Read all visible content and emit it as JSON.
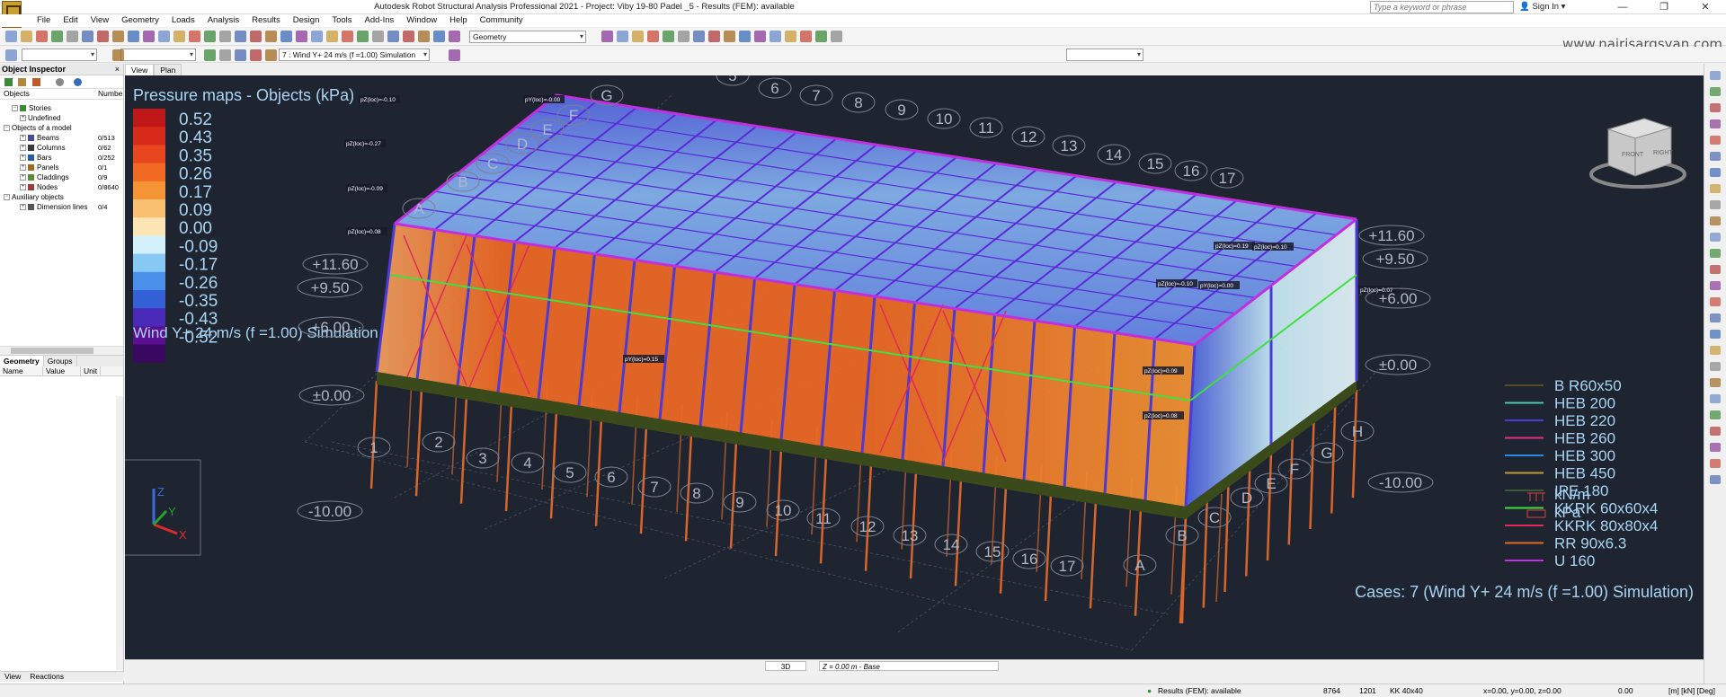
{
  "window": {
    "title": "Autodesk Robot Structural Analysis Professional 2021 - Project: Viby 19-80 Padel _5 - Results (FEM): available",
    "search_placeholder": "Type a keyword or phrase",
    "sign_in": "Sign In",
    "controls": [
      "—",
      "❐",
      "✕"
    ]
  },
  "menu": [
    "File",
    "Edit",
    "View",
    "Geometry",
    "Loads",
    "Analysis",
    "Results",
    "Design",
    "Tools",
    "Add-Ins",
    "Window",
    "Help",
    "Community"
  ],
  "toolbar": {
    "layout_combo": "Geometry",
    "case_combo": "7 : Wind Y+ 24 m/s (f =1.00) Simulation",
    "watermark": "www.nairisargsyan.com"
  },
  "object_inspector": {
    "title": "Object Inspector",
    "columns": [
      "Objects",
      "Numbe"
    ],
    "tree": [
      {
        "label": "Stories",
        "count": "",
        "indent": 1,
        "expander": "−",
        "color": "#3a8a3a"
      },
      {
        "label": "Undefined",
        "count": "",
        "indent": 2,
        "expander": "+",
        "color": ""
      },
      {
        "label": "Objects of a model",
        "count": "",
        "indent": 0,
        "expander": "−",
        "color": ""
      },
      {
        "label": "Beams",
        "count": "0/513",
        "indent": 2,
        "expander": "+",
        "color": "#4a4a9a"
      },
      {
        "label": "Columns",
        "count": "0/62",
        "indent": 2,
        "expander": "+",
        "color": "#3a3a3a"
      },
      {
        "label": "Bars",
        "count": "0/252",
        "indent": 2,
        "expander": "+",
        "color": "#2a5aa0"
      },
      {
        "label": "Panels",
        "count": "0/1",
        "indent": 2,
        "expander": "+",
        "color": "#a06a20"
      },
      {
        "label": "Claddings",
        "count": "0/9",
        "indent": 2,
        "expander": "+",
        "color": "#5a8a3a"
      },
      {
        "label": "Nodes",
        "count": "0/8640",
        "indent": 2,
        "expander": "+",
        "color": "#a03a3a"
      },
      {
        "label": "Auxiliary objects",
        "count": "",
        "indent": 0,
        "expander": "−",
        "color": ""
      },
      {
        "label": "Dimension lines",
        "count": "0/4",
        "indent": 2,
        "expander": "+",
        "color": "#555"
      }
    ],
    "tabs": [
      "Geometry",
      "Groups"
    ],
    "grid_columns": [
      "Name",
      "Value",
      "Unit"
    ],
    "bottom_tabs": [
      "View",
      "Reactions"
    ]
  },
  "view_tabs": [
    "View",
    "Plan"
  ],
  "viewport": {
    "map_title": "Pressure maps - Objects (kPa)",
    "legend": [
      {
        "value": "0.52",
        "color": "#c01818"
      },
      {
        "value": "0.43",
        "color": "#d82a1a"
      },
      {
        "value": "0.35",
        "color": "#e8461e"
      },
      {
        "value": "0.26",
        "color": "#f06a24"
      },
      {
        "value": "0.17",
        "color": "#f49434"
      },
      {
        "value": "0.09",
        "color": "#f8c070"
      },
      {
        "value": "0.00",
        "color": "#fde4b4"
      },
      {
        "value": "-0.09",
        "color": "#d2f0fa"
      },
      {
        "value": "-0.17",
        "color": "#88c8f4"
      },
      {
        "value": "-0.26",
        "color": "#4a90ea"
      },
      {
        "value": "-0.35",
        "color": "#3460d8"
      },
      {
        "value": "-0.43",
        "color": "#4a2ab8"
      },
      {
        "value": "-0.52",
        "color": "#5a1090"
      }
    ],
    "legend_last_color": "#3a0860",
    "case_label": "Wind Y+ 24 m/s (f =1.00) Simulation",
    "cases_footer": "Cases: 7 (Wind Y+ 24 m/s (f =1.00) Simulation)",
    "sections": [
      {
        "name": "B R60x50",
        "color": "#5a4a2a"
      },
      {
        "name": "HEB 200",
        "color": "#4ac8a8"
      },
      {
        "name": "HEB 220",
        "color": "#4a3ad8"
      },
      {
        "name": "HEB 260",
        "color": "#e0308a"
      },
      {
        "name": "HEB 300",
        "color": "#2a8ae0"
      },
      {
        "name": "HEB 450",
        "color": "#b89a3a"
      },
      {
        "name": "IPE 180",
        "color": "#3a5a3a"
      },
      {
        "name": "KKRK 60x60x4",
        "color": "#40e040"
      },
      {
        "name": "KKRK 80x80x4",
        "color": "#e02a5a"
      },
      {
        "name": "RR 90x6.3",
        "color": "#e06a2a"
      },
      {
        "name": "U 160",
        "color": "#c030e0"
      }
    ],
    "units": [
      "kN/m",
      "kPa"
    ],
    "nav_cube_labels": [
      "FRONT",
      "RIGHT"
    ],
    "levels_left": [
      "+11.60",
      "+9.50",
      "+6.00",
      "±0.00",
      "-10.00"
    ],
    "levels_right": [
      "+11.60",
      "+9.50",
      "+6.00",
      "±0.00",
      "-10.00"
    ],
    "axes_numbers_top": [
      "5",
      "6",
      "7",
      "8",
      "9",
      "10",
      "11",
      "12",
      "13",
      "14",
      "15",
      "16",
      "17"
    ],
    "axes_letters_top": [
      "A",
      "B",
      "C",
      "D",
      "E",
      "F",
      "G"
    ],
    "axes_numbers_bottom": [
      "1",
      "2",
      "3",
      "4",
      "5",
      "6",
      "7",
      "8",
      "9",
      "10",
      "11",
      "12",
      "13",
      "14",
      "15",
      "16",
      "17"
    ],
    "axes_letters_bottom": [
      "A",
      "B",
      "C",
      "D",
      "E",
      "F",
      "G",
      "H"
    ],
    "value_tags": [
      "pZ(loc)=-0.10",
      "pY(loc)=-0.00",
      "pZ(loc)=-0.27",
      "pZ(loc)=-0.09",
      "pZ(loc)=0.08",
      "pY(loc)=0.15",
      "pZ(loc)=0.19",
      "pZ(loc)=0.10",
      "pZ(loc)=-0.10",
      "pY(loc)=0.00",
      "pZ(loc)=0.07",
      "pZ(loc)=0.09",
      "pZ(loc)=0.08"
    ],
    "triad": [
      "Z",
      "Y",
      "X"
    ]
  },
  "view_status": {
    "mode": "3D",
    "plane": "Z = 0.00 m - Base"
  },
  "status": {
    "results": "Results (FEM): available",
    "n1": "8764",
    "n2": "1201",
    "section": "KK 40x40",
    "coords": "x=0.00, y=0.00, z=0.00",
    "angle": "0.00",
    "units": "[m] [kN] [Deg]"
  }
}
